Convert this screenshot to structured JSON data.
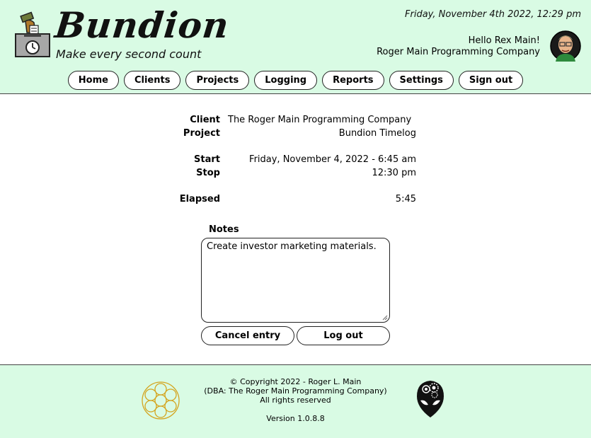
{
  "header": {
    "brand": "Bundion",
    "tagline": "Make every second count",
    "datetime": "Friday, November 4th 2022, 12:29 pm",
    "greeting": "Hello Rex Main!",
    "company": "Roger Main Programming Company"
  },
  "nav": {
    "items": [
      "Home",
      "Clients",
      "Projects",
      "Logging",
      "Reports",
      "Settings",
      "Sign out"
    ]
  },
  "entry": {
    "client_label": "Client",
    "client_value": "The Roger Main Programming Company",
    "project_label": "Project",
    "project_value": "Bundion Timelog",
    "start_label": "Start",
    "start_value": "Friday, November 4, 2022 - 6:45 am",
    "stop_label": "Stop",
    "stop_value": "12:30 pm",
    "elapsed_label": "Elapsed",
    "elapsed_value": "5:45",
    "notes_label": "Notes",
    "notes_value": "Create investor marketing materials.",
    "cancel_label": "Cancel entry",
    "logout_label": "Log out"
  },
  "footer": {
    "copyright": "© Copyright 2022 - Roger L. Main",
    "dba": "(DBA: The Roger Main Programming Company)",
    "rights": "All rights reserved",
    "version": "Version 1.0.8.8"
  },
  "colors": {
    "header_bg": "#d9fbe4",
    "footer_bg": "#d9fbe4",
    "flower_gold": "#d4a520"
  }
}
